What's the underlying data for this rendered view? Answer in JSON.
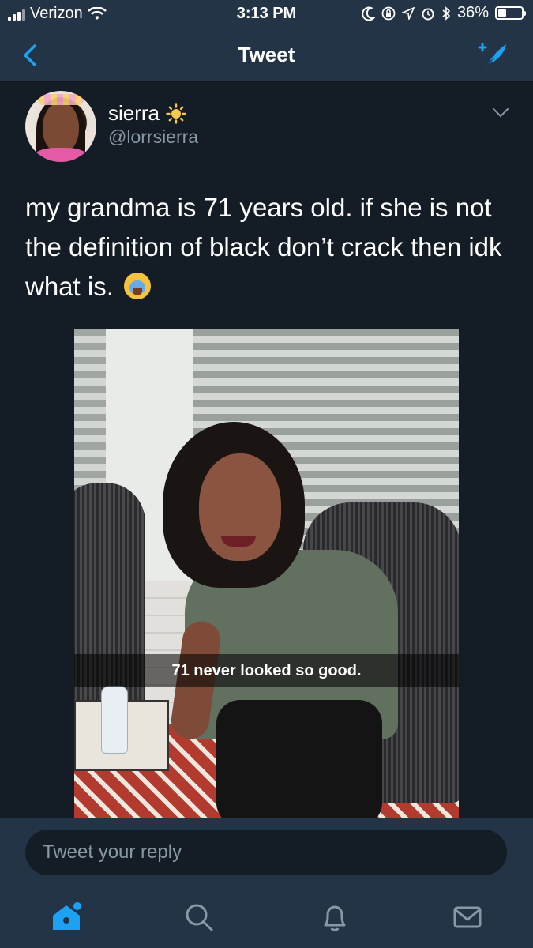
{
  "status_bar": {
    "carrier": "Verizon",
    "time": "3:13 PM",
    "battery": "36%",
    "battery_level": 0.36,
    "icons": [
      "signal-icon",
      "wifi-icon",
      "moon-icon",
      "rotation-lock-icon",
      "location-icon",
      "alarm-icon",
      "bluetooth-icon",
      "battery-icon"
    ]
  },
  "nav": {
    "title": "Tweet",
    "back_icon": "chevron-left-icon",
    "compose_icon": "compose-tweet-icon"
  },
  "tweet": {
    "display_name": "sierra",
    "handle": "@lorrsierra",
    "name_emoji": "sun-icon",
    "text": "my grandma is 71 years old. if she is not the definition of black don’t crack then idk what is.",
    "text_emoji": "loudly-crying-face-icon",
    "photo_caption": "71 never looked so good."
  },
  "reply": {
    "placeholder": "Tweet your reply"
  },
  "tabs": [
    {
      "name": "home",
      "icon": "home-icon",
      "active": true
    },
    {
      "name": "search",
      "icon": "search-icon",
      "active": false
    },
    {
      "name": "notifications",
      "icon": "bell-icon",
      "active": false
    },
    {
      "name": "messages",
      "icon": "mail-icon",
      "active": false
    }
  ],
  "colors": {
    "background": "#141d26",
    "bar": "#243447",
    "accent": "#1da1f2",
    "secondary_text": "#8899a6"
  }
}
